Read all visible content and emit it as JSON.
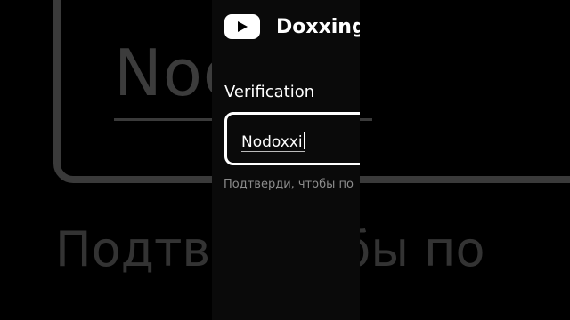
{
  "header": {
    "channel_title": "Doxxing",
    "logo_icon": "youtube-logo-icon",
    "accent_color": "#ffffff"
  },
  "form": {
    "label": "Verification",
    "value": "Nodoxxi",
    "hint": "Подтверди, чтобы по"
  },
  "background": {
    "input_text": "Nod",
    "hint_text": "Подтве    чтобы по"
  }
}
